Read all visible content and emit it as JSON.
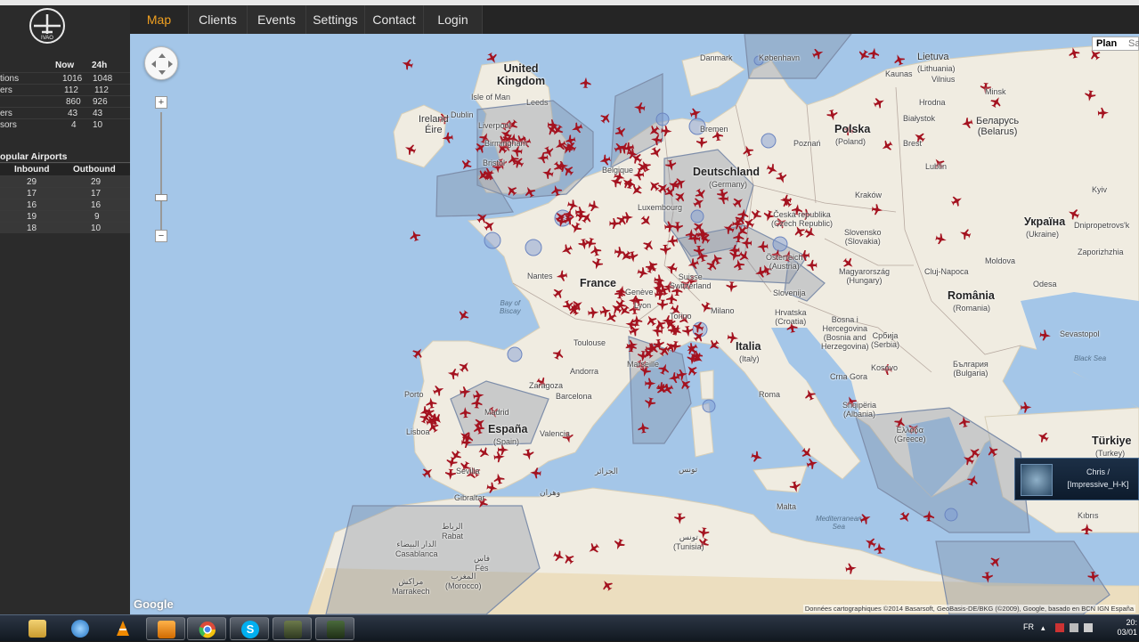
{
  "nav": {
    "items": [
      "Map",
      "Clients",
      "Events",
      "Settings",
      "Contact",
      "Login"
    ],
    "active": "Map"
  },
  "stats": {
    "headers": [
      "Now",
      "24h"
    ],
    "rows": [
      {
        "label": "tions",
        "now": "1016",
        "day": "1048"
      },
      {
        "label": "ers",
        "now": "112",
        "day": "112"
      },
      {
        "label": "",
        "now": "860",
        "day": "926"
      },
      {
        "label": "ers",
        "now": "43",
        "day": "43"
      },
      {
        "label": "sors",
        "now": "4",
        "day": "10"
      }
    ]
  },
  "popular_airports": {
    "title": "opular Airports",
    "headers": [
      "Inbound",
      "Outbound"
    ],
    "rows": [
      {
        "inbound": "29",
        "outbound": "29"
      },
      {
        "inbound": "17",
        "outbound": "17"
      },
      {
        "inbound": "16",
        "outbound": "16"
      },
      {
        "inbound": "19",
        "outbound": "9"
      },
      {
        "inbound": "18",
        "outbound": "10"
      }
    ]
  },
  "map": {
    "type_buttons": [
      "Plan",
      "Sa"
    ],
    "google": "Google",
    "attribution": "Données cartographiques ©2014 Basarsoft, GeoBasis-DE/BKG (©2009), Google, basado en BCN IGN España",
    "labels": {
      "uk": "United\nKingdom",
      "ireland": "Ireland\nÉire",
      "isle_of_man": "Isle of Man",
      "liverpool": "Liverpool",
      "leeds": "Leeds",
      "birmingham": "Birmingham",
      "bristol": "Bristol",
      "dublin": "Dublin",
      "danmark": "Danmark",
      "kobenhavn": "København",
      "deutschland": "Deutschland",
      "germany": "(Germany)",
      "bremen": "Bremen",
      "polska": "Polska",
      "poland": "(Poland)",
      "poznan": "Poznań",
      "krakow": "Kraków",
      "lublin": "Lublin",
      "bialystok": "Białystok",
      "lietuva": "Lietuva",
      "lithuania": "(Lithuania)",
      "minsk": "Minsk",
      "belarus": "Беларусь\n(Belarus)",
      "vilnius": "Vilnius",
      "kaunas": "Kaunas",
      "hrodna": "Hrodna",
      "brest": "Brest",
      "ukraina": "Україна",
      "ukraine": "(Ukraine)",
      "dnipro": "Dnipropetrovs'k",
      "zaporizhzhia": "Zaporizhzhia",
      "kiev": "Kyiv",
      "moldova": "Moldova",
      "odesa": "Odesa",
      "france": "France",
      "nantes": "Nantes",
      "bay_of_biscay": "Bay of\nBiscay",
      "toulouse": "Toulouse",
      "marseille": "Marseille",
      "lyon": "Lyon",
      "geneve": "Genève",
      "luxembourg": "Luxembourg",
      "belgique": "Belgique",
      "suisse": "Suisse\nSwitzerland",
      "milano": "Milano",
      "torino": "Torino",
      "italia": "Italia",
      "italy": "(Italy)",
      "roma": "Roma",
      "espana": "España",
      "spain": "(Spain)",
      "madrid": "Madrid",
      "barcelona": "Barcelona",
      "zaragoza": "Zaragoza",
      "andorra": "Andorra",
      "porto": "Porto",
      "lisboa": "Lisboa",
      "sevilla": "Sevilla",
      "gibraltar": "Gibraltar",
      "valencia": "Valencia",
      "cesko": "Česká republika\n(Czech Republic)",
      "osterreich": "Österreich\n(Austria)",
      "slovensko": "Slovensko\n(Slovakia)",
      "magyar": "Magyarország\n(Hungary)",
      "slovenija": "Slovenija",
      "hrvatska": "Hrvatska\n(Croatia)",
      "bosna": "Bosna i\nHercegovina\n(Bosnia and\nHerzegovina)",
      "srbija": "Србија\n(Serbia)",
      "crna_gora": "Crna Gora",
      "kosovo": "Kosovo",
      "shqiperia": "Shqipëria\n(Albania)",
      "bulgaria": "България\n(Bulgaria)",
      "romania": "România",
      "romania_en": "(Romania)",
      "cluj": "Cluj-Napoca",
      "ellada": "Ελλάδα\n(Greece)",
      "turkiye": "Türkiye",
      "turkey": "(Turkey)",
      "black_sea": "Black Sea",
      "sevastopol": "Sevastopol",
      "kibris": "Kıbrıs",
      "alger": "الجزائر",
      "tunis": "تونس",
      "rabat": "الرباط\nRabat",
      "casablanca": "الدار البيضاء\nCasablanca",
      "fes": "فاس\nFès",
      "marrakech": "مراكش\nMarrakech",
      "maroc": "المغرب\n(Morocco)",
      "tunisie": "تونس\n(Tunisia)",
      "wahran": "وهران",
      "malta": "Malta",
      "med_sea": "Mediterranean\nSea"
    }
  },
  "notification": {
    "line1": "Chris /",
    "line2": "[Impressive_H-K]"
  },
  "taskbar": {
    "lang": "FR",
    "time": "20:",
    "date": "03/01"
  }
}
